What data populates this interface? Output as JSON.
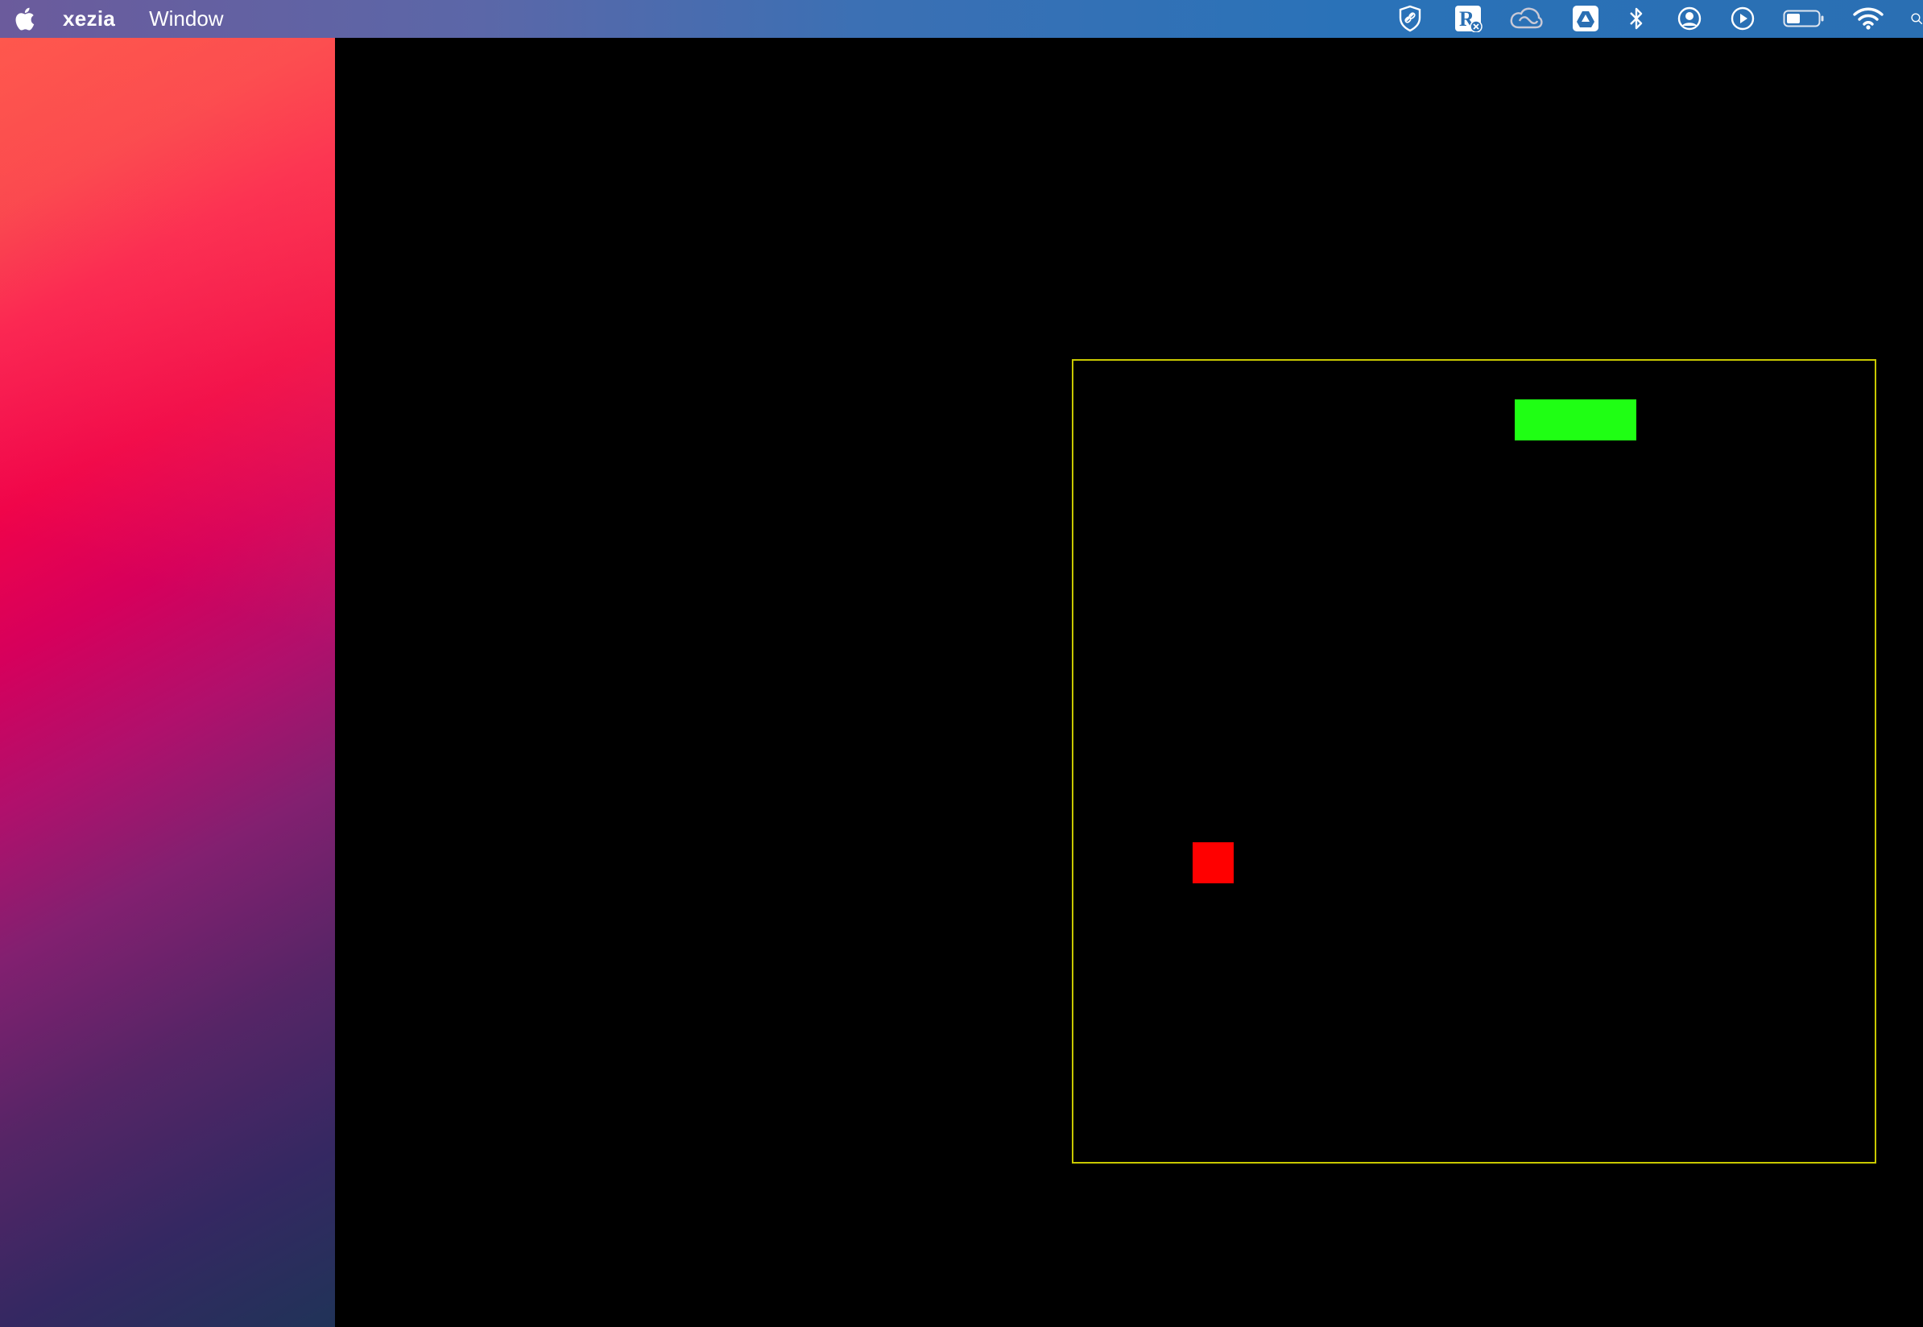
{
  "menubar": {
    "app_name": "xezia",
    "menu_items": [
      "Window"
    ],
    "status_icons": [
      "shield-link-icon",
      "rx-app-icon",
      "creative-cloud-icon",
      "google-drive-icon",
      "bluetooth-icon",
      "user-account-icon",
      "play-circle-icon",
      "battery-icon",
      "wifi-icon",
      "search-icon"
    ]
  },
  "game": {
    "board_border_color": "#c8c800",
    "background_color": "#000000",
    "snake_color": "#1fff14",
    "food_color": "#ff0000"
  },
  "colors": {
    "menubar_text": "#ffffff"
  }
}
